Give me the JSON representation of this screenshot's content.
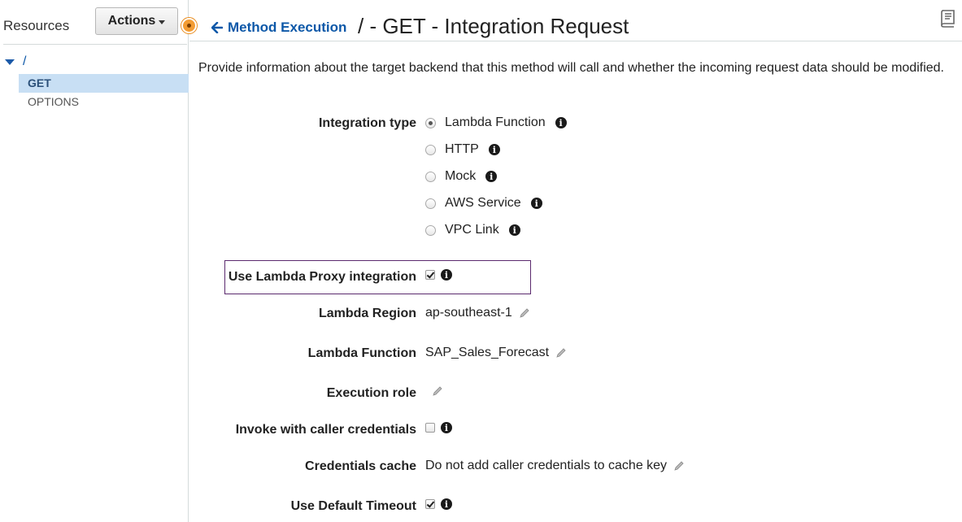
{
  "sidebar": {
    "title": "Resources",
    "actions_label": "Actions",
    "tree": {
      "root": "/",
      "items": [
        {
          "label": "GET",
          "selected": true
        },
        {
          "label": "OPTIONS",
          "selected": false
        }
      ]
    }
  },
  "header": {
    "back_link": "Method Execution",
    "title": "/ - GET - Integration Request",
    "description": "Provide information about the target backend that this method will call and whether the incoming request data should be modified."
  },
  "form": {
    "integration_type": {
      "label": "Integration type",
      "options": [
        "Lambda Function",
        "HTTP",
        "Mock",
        "AWS Service",
        "VPC Link"
      ],
      "selected": "Lambda Function"
    },
    "lambda_proxy": {
      "label": "Use Lambda Proxy integration",
      "checked": true
    },
    "lambda_region": {
      "label": "Lambda Region",
      "value": "ap-southeast-1"
    },
    "lambda_function": {
      "label": "Lambda Function",
      "value": "SAP_Sales_Forecast"
    },
    "execution_role": {
      "label": "Execution role",
      "value": ""
    },
    "invoke_caller_credentials": {
      "label": "Invoke with caller credentials",
      "checked": false
    },
    "credentials_cache": {
      "label": "Credentials cache",
      "value": "Do not add caller credentials to cache key"
    },
    "default_timeout": {
      "label": "Use Default Timeout",
      "checked": true
    }
  },
  "colors": {
    "link": "#0d58a8",
    "selected_row": "#c8dff4",
    "highlight_box": "#5b2a6e",
    "badge": "#f39c33"
  }
}
